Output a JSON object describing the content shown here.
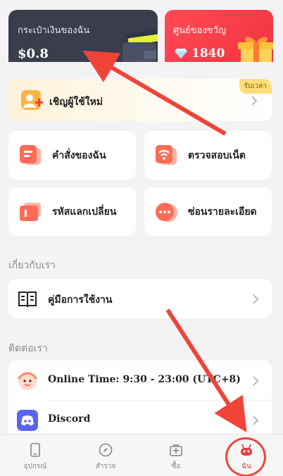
{
  "wallet": {
    "title": "กระเป๋าเงินของฉัน",
    "balance": "$0.8"
  },
  "gift_center": {
    "title": "ศูนย์ของขวัญ",
    "diamonds": "1840"
  },
  "invite": {
    "label": "เชิญผู้ใช้ใหม่",
    "tag": "รับเวลา"
  },
  "tiles": [
    {
      "label": "คำสั่งของฉัน",
      "icon": "orders-icon"
    },
    {
      "label": "ตรวจสอบเน็ต",
      "icon": "network-check-icon"
    },
    {
      "label": "รหัสแลกเปลี่ยน",
      "icon": "redeem-code-icon"
    },
    {
      "label": "ซ่อนรายละเอียด",
      "icon": "hide-details-icon"
    }
  ],
  "about": {
    "title": "เกี่ยวกับเรา",
    "items": [
      {
        "label": "คู่มือการใช้งาน",
        "icon": "book-icon"
      }
    ]
  },
  "contact": {
    "title": "ติดต่อเรา",
    "items": [
      {
        "label": "Online Time: 9:30 - 23:00 (UTC+8)",
        "icon": "support-avatar-icon"
      },
      {
        "label": "Discord",
        "icon": "discord-icon"
      }
    ]
  },
  "tabbar": {
    "active": "ฉัน",
    "tabs": [
      {
        "label": "อุปกรณ์",
        "icon": "device-icon"
      },
      {
        "label": "สำรวจ",
        "icon": "compass-icon"
      },
      {
        "label": "ซื้อ",
        "icon": "shop-icon"
      },
      {
        "label": "ฉัน",
        "icon": "profile-icon"
      }
    ]
  },
  "colors": {
    "accent": "#f04438",
    "wallet_card": "#3a3e4c",
    "gift_card": "#ff4a56",
    "annotation_arrow": "#f04438"
  }
}
